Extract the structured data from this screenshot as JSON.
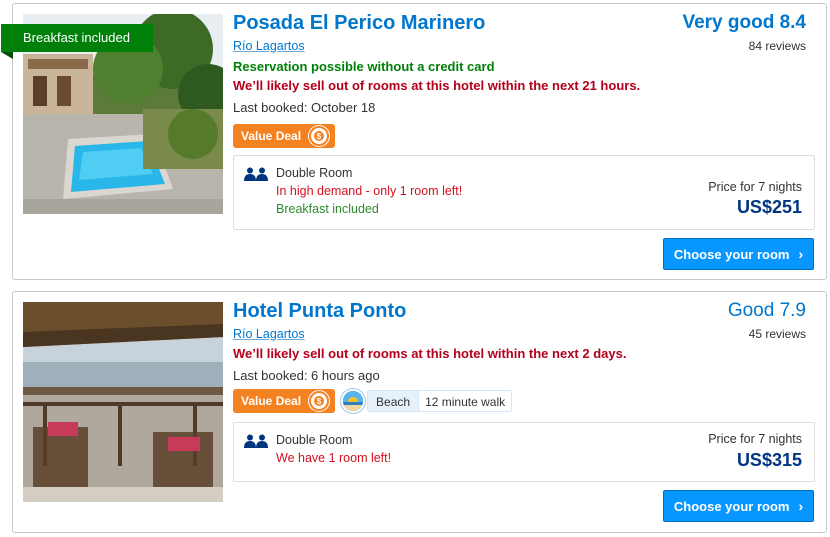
{
  "hotels": [
    {
      "ribbon": "Breakfast included",
      "name": "Posada El Perico Marinero",
      "location": "Río Lagartos",
      "no_card": "Reservation possible without a credit card",
      "sellout": "We’ll likely sell out of rooms at this hotel within the next 21 hours.",
      "last_booked": "Last booked: October 18",
      "score_text": "Very good 8.4",
      "reviews": "84 reviews",
      "value_deal": "Value Deal",
      "room": {
        "name": "Double Room",
        "line1": "In high demand - only 1 room left!",
        "line2": "Breakfast included",
        "price_label": "Price for 7 nights",
        "price": "US$251"
      },
      "cta": "Choose your room",
      "icons": [
        "value-deal-icon",
        "double-room-icon",
        "chevron-right-icon"
      ]
    },
    {
      "name": "Hotel Punta Ponto",
      "location": "Río Lagartos",
      "sellout": "We’ll likely sell out of rooms at this hotel within the next 2 days.",
      "last_booked": "Last booked: 6 hours ago",
      "score_text": "Good 7.9",
      "reviews": "45 reviews",
      "value_deal": "Value Deal",
      "beach": "Beach",
      "walk": "12 minute walk",
      "room": {
        "name": "Double Room",
        "line1": "We have 1 room left!",
        "price_label": "Price for 7 nights",
        "price": "US$315"
      },
      "cta": "Choose your room",
      "icons": [
        "value-deal-icon",
        "beach-icon",
        "double-room-icon",
        "chevron-right-icon"
      ]
    }
  ],
  "colors": {
    "link_blue": "#0077cc",
    "ribbon_green": "#008009",
    "urgency_red": "#b3001b",
    "deal_orange": "#f58220",
    "price_navy": "#003580",
    "button_blue": "#0896ff"
  }
}
